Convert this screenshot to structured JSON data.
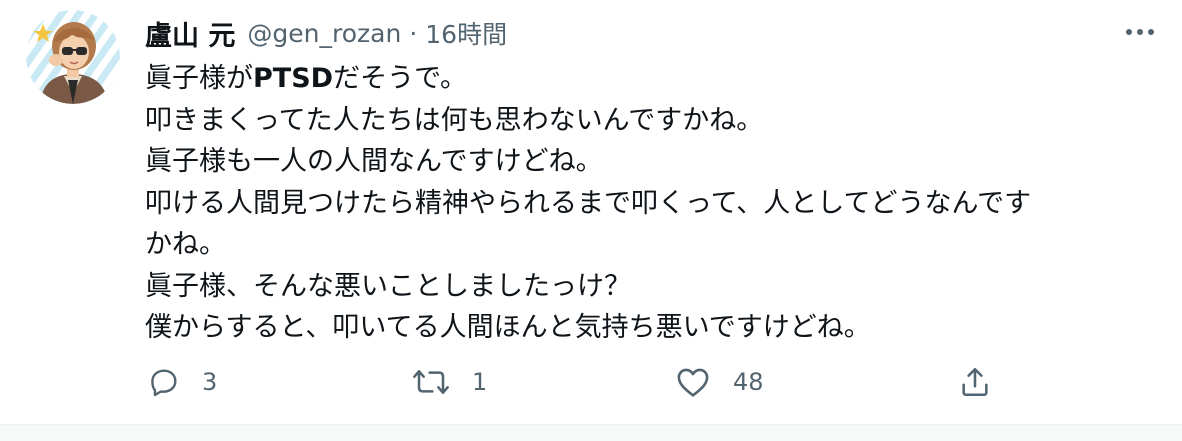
{
  "tweet": {
    "display_name": "盧山 元",
    "handle": "@gen_rozan",
    "separator": "·",
    "timestamp": "16時間",
    "body": {
      "line1_prefix": "眞子様が",
      "line1_bold": "PTSD",
      "line1_suffix": "だそうで。",
      "line2": "叩きまくってた人たちは何も思わないんですかね。",
      "line3": "眞子様も一人の人間なんですけどね。",
      "line4": "叩ける人間見つけたら精神やられるまで叩くって、人としてどうなんです",
      "line5": "かね。",
      "line6": "眞子様、そんな悪いことしましたっけ？",
      "line7": "僕からすると、叩いてる人間ほんと気持ち悪いですけどね。"
    },
    "actions": {
      "reply_count": "3",
      "retweet_count": "1",
      "like_count": "48"
    },
    "icons": {
      "more": "more-horizontal-icon",
      "reply": "reply-icon",
      "retweet": "retweet-icon",
      "like": "heart-icon",
      "share": "share-icon"
    }
  },
  "colors": {
    "text_primary": "#0f1419",
    "text_secondary": "#536471",
    "background": "#ffffff"
  }
}
